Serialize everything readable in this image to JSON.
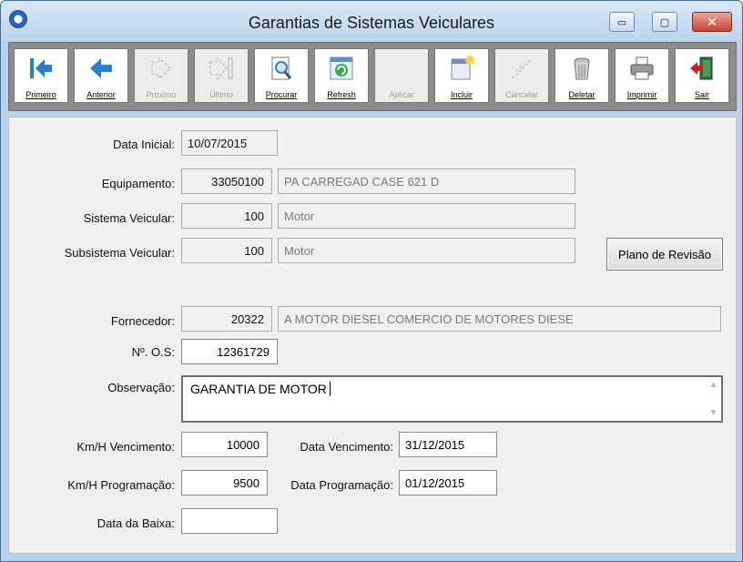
{
  "window": {
    "title": "Garantias de Sistemas Veiculares",
    "controls": {
      "minimize": "▭",
      "maximize": "▢",
      "close": "✕"
    }
  },
  "toolbar": {
    "buttons": [
      {
        "label": "Primeiro",
        "icon": "first-record-icon",
        "enabled": true
      },
      {
        "label": "Anterior",
        "icon": "previous-record-icon",
        "enabled": true
      },
      {
        "label": "Próximo",
        "icon": "next-record-icon",
        "enabled": false
      },
      {
        "label": "Último",
        "icon": "last-record-icon",
        "enabled": false
      },
      {
        "label": "Procurar",
        "icon": "search-icon",
        "enabled": true
      },
      {
        "label": "Refresh",
        "icon": "refresh-icon",
        "enabled": true
      },
      {
        "label": "Aplicar",
        "icon": "apply-icon",
        "enabled": false
      },
      {
        "label": "Incluir",
        "icon": "new-record-icon",
        "enabled": true
      },
      {
        "label": "Cancelar",
        "icon": "cancel-icon",
        "enabled": false
      },
      {
        "label": "Deletar",
        "icon": "trash-icon",
        "enabled": true
      },
      {
        "label": "Imprimir",
        "icon": "printer-icon",
        "enabled": true
      },
      {
        "label": "Sair",
        "icon": "exit-icon",
        "enabled": true
      }
    ]
  },
  "form": {
    "data_inicial": {
      "label": "Data Inicial:",
      "value": "10/07/2015"
    },
    "equipamento": {
      "label": "Equipamento:",
      "code": "33050100",
      "description": "PA CARREGAD CASE 621 D"
    },
    "sistema": {
      "label": "Sistema Veicular:",
      "code": "100",
      "description": "Motor"
    },
    "subsistema": {
      "label": "Subsistema Veicular:",
      "code": "100",
      "description": "Motor"
    },
    "plano_button": "Plano de Revisão",
    "fornecedor": {
      "label": "Fornecedor:",
      "code": "20322",
      "description": "A MOTOR DIESEL COMERCIO DE MOTORES DIESE"
    },
    "os": {
      "label": "Nº. O.S:",
      "value": "12361729"
    },
    "observacao": {
      "label": "Observação:",
      "value": "GARANTIA DE MOTOR"
    },
    "km_vencimento": {
      "label": "Km/H Vencimento:",
      "value": "10000"
    },
    "data_vencimento": {
      "label": "Data Vencimento:",
      "value": "31/12/2015"
    },
    "km_programacao": {
      "label": "Km/H Programação:",
      "value": "9500"
    },
    "data_programacao": {
      "label": "Data Programação:",
      "value": "01/12/2015"
    },
    "data_baixa": {
      "label": "Data da Baixa:",
      "value": ""
    }
  }
}
